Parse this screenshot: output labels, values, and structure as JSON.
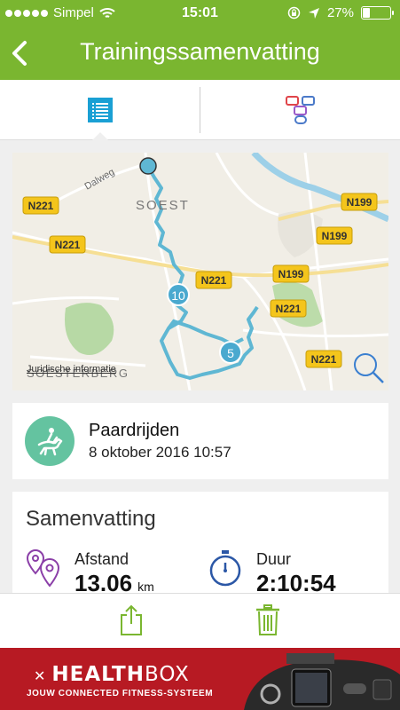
{
  "status_bar": {
    "carrier": "Simpel",
    "time": "15:01",
    "battery": "27%",
    "battery_level": 0.27
  },
  "nav": {
    "title": "Trainingssamenvatting"
  },
  "tabs": [
    {
      "name": "list-view",
      "icon": "list-icon",
      "selected": true
    },
    {
      "name": "chat-view",
      "icon": "chat-bubbles-icon",
      "selected": false
    }
  ],
  "map": {
    "road_labels": [
      "N221",
      "N221",
      "N221",
      "N199",
      "N199",
      "N199",
      "N221",
      "N221"
    ],
    "street_labels": [
      "Dalweg"
    ],
    "place_labels": [
      "SOEST",
      "SOESTERBERG"
    ],
    "markers": [
      "10",
      "5"
    ],
    "legal": "Juridische informatie",
    "colors": {
      "route": "#5fb7d3",
      "marker": "#4aa9cf",
      "road_badge": "#f4c51c",
      "park": "#b7d9a5"
    }
  },
  "activity": {
    "name": "Paardrijden",
    "date": "8 oktober 2016 10:57",
    "icon": "horse-rider-icon",
    "color": "#64c3a0"
  },
  "summary": {
    "heading": "Samenvatting",
    "distance": {
      "label": "Afstand",
      "value": "13.06",
      "unit": "km",
      "icon": "map-pins-icon"
    },
    "duration": {
      "label": "Duur",
      "value": "2:10:54",
      "icon": "stopwatch-icon"
    }
  },
  "actions": [
    {
      "name": "share",
      "icon": "share-icon"
    },
    {
      "name": "delete",
      "icon": "trash-icon"
    }
  ],
  "ad": {
    "brand_main": "HEALTH",
    "brand_sub": "BOX",
    "tagline": "JOUW CONNECTED FITNESS-SYSTEEM",
    "background": "#b71a23"
  },
  "colors": {
    "accent": "#7ab630",
    "tab_icon": "#1aa0d4"
  }
}
